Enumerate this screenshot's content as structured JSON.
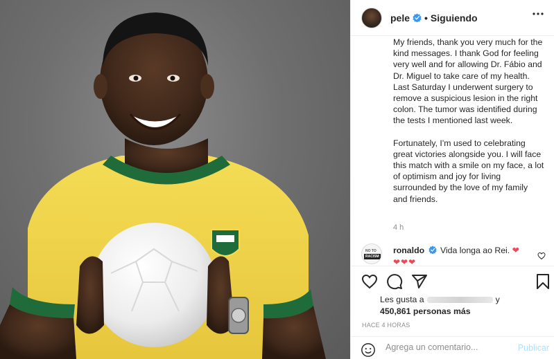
{
  "post": {
    "photo_alt": "",
    "author": {
      "username": "pele",
      "verified": true,
      "separator": "•",
      "follow_status": "Siguiendo"
    },
    "caption_paragraphs": [
      "My friends, thank you very much for the kind messages. I thank God for feeling very well and for allowing Dr. Fábio and Dr. Miguel to take care of my health. Last Saturday I underwent surgery to remove a suspicious lesion in the right colon. The tumor was identified during the tests I mentioned last week.",
      "Fortunately, I'm used to celebrating great victories alongside you. I will face this match with a smile on my face, a lot of optimism and joy for living surrounded by the love of my family and friends."
    ],
    "caption_time": "4 h",
    "comments": [
      {
        "username": "ronaldo",
        "verified": true,
        "text": "Vida longa ao Rei.",
        "heart": "❤",
        "hearts_line": "❤❤❤",
        "avatar_text_top": "NO TO",
        "avatar_text_bottom": "RACISM"
      }
    ],
    "likes": {
      "prefix": "Les gusta a",
      "suffix": "y",
      "count_text": "450,861 personas más"
    },
    "posted_ago": "HACE 4 HORAS",
    "add_comment": {
      "placeholder": "Agrega un comentario...",
      "publish_label": "Publicar"
    }
  },
  "colors": {
    "jersey_yellow": "#f2d64b",
    "jersey_green": "#1f6b3a",
    "verified_blue": "#3897f0",
    "heart_red": "#ed4956",
    "publish_disabled": "#b2dffc"
  },
  "icons": {
    "header": [
      "verified-badge-icon",
      "more-options-icon"
    ],
    "actions": [
      "heart-icon",
      "comment-icon",
      "share-icon",
      "bookmark-icon"
    ],
    "comment_input": "emoji-icon"
  }
}
